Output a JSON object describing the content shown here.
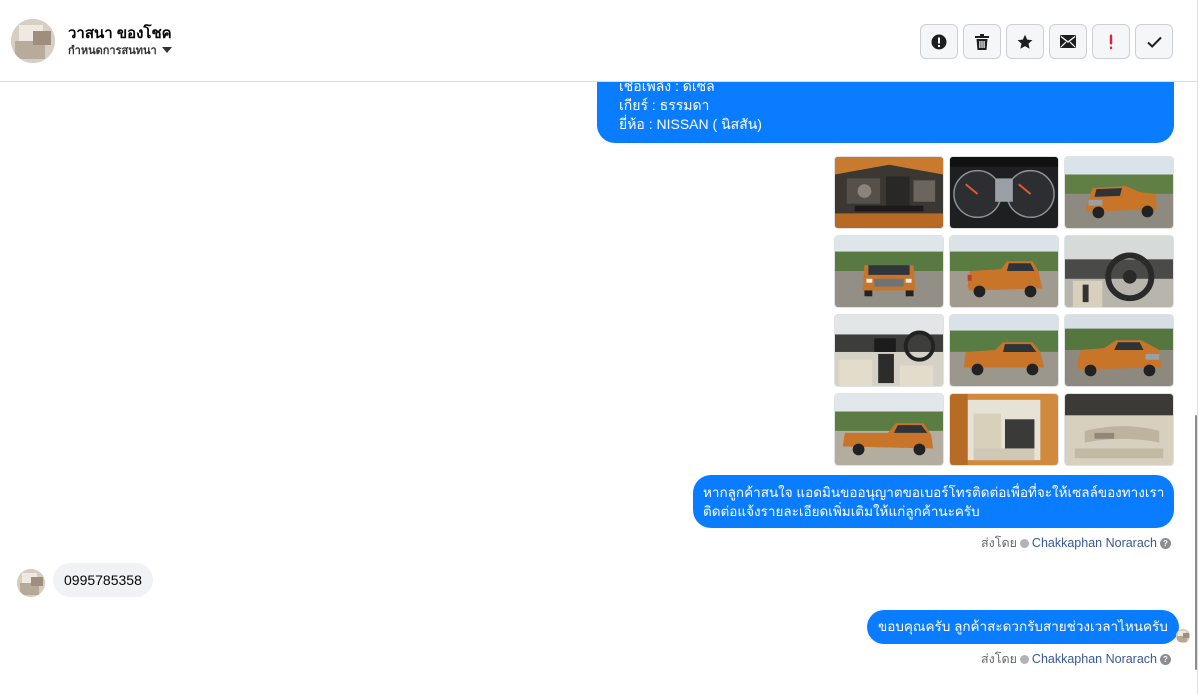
{
  "header": {
    "contact_name": "วาสนา ของโชค",
    "status_label": "กำหนดการสนทนา"
  },
  "toolbar": {
    "buttons": [
      {
        "name": "report-button",
        "icon": "exclamation-circle-icon"
      },
      {
        "name": "delete-button",
        "icon": "trash-icon"
      },
      {
        "name": "star-button",
        "icon": "star-icon"
      },
      {
        "name": "mark-unread-button",
        "icon": "envelope-icon"
      },
      {
        "name": "spam-button",
        "icon": "exclamation-icon"
      },
      {
        "name": "mark-done-button",
        "icon": "check-icon"
      }
    ]
  },
  "messages": {
    "spec_lines": [
      "เชื้อเพลิง : ดีเซล",
      "เกียร์ : ธรรมดา",
      "ยี่ห้อ : NISSAN ( นิสสัน)"
    ],
    "photos": [
      "engine-bay",
      "dashboard-gauges",
      "truck-front-angle",
      "truck-front",
      "truck-rear-angle",
      "steering-wheel",
      "interior-console",
      "truck-side-rear",
      "truck-front-right",
      "truck-side",
      "interior-doors-open",
      "door-panel"
    ],
    "offer_lines": [
      "หากลูกค้าสนใจ แอดมินขออนุญาตขอเบอร์โทรติดต่อเพื่อที่จะให้เซลล์ของทางเรา",
      "ติดต่อแจ้งรายละเอียดเพิ่มเติมให้แก่ลูกค้านะครับ"
    ],
    "sent_by_prefix": "ส่งโดย",
    "sent_by_name": "Chakkaphan Norarach",
    "customer_phone": "0995785358",
    "reply_text": "ขอบคุณครับ ลูกค้าสะดวกรับสายช่วงเวลาไหนครับ"
  },
  "colors": {
    "outgoing_bubble": "#0a7cff",
    "incoming_bubble": "#f0f2f5",
    "truck_orange": "#c8752a"
  }
}
